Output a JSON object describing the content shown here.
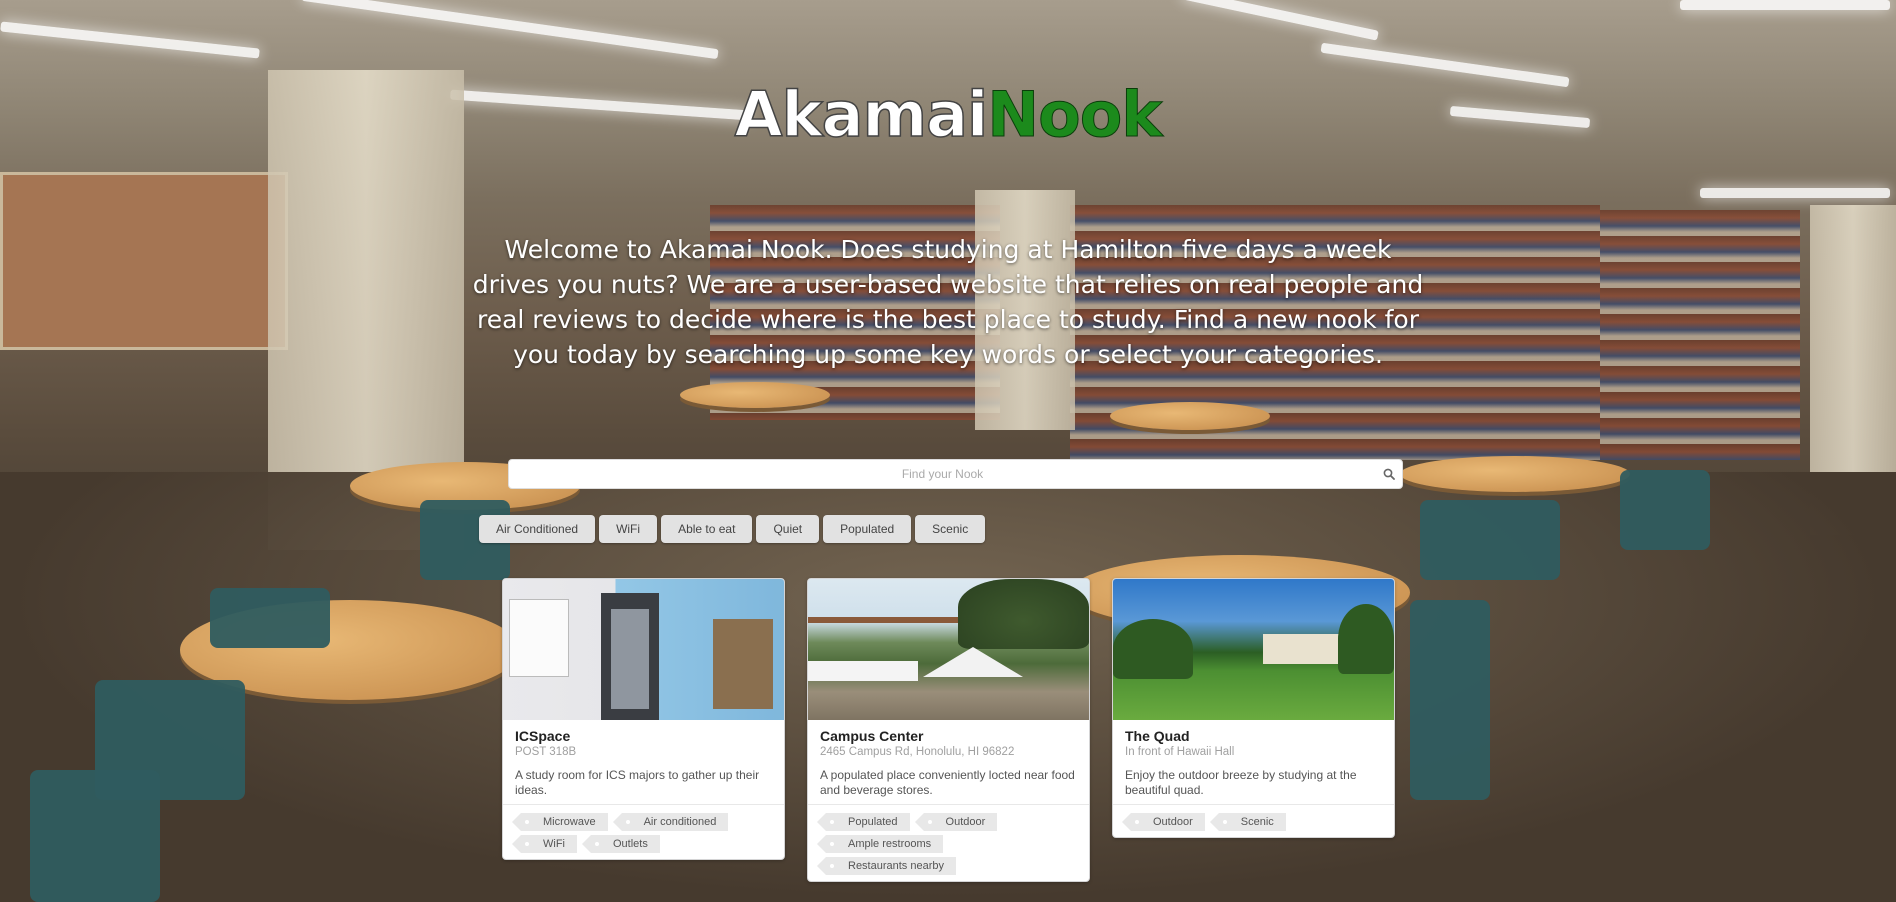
{
  "brand": {
    "name_part1": "Akamai",
    "name_part2": "Nook"
  },
  "welcome_text": "Welcome to Akamai Nook. Does studying at Hamilton five days a week drives you nuts? We are a user-based website that relies on real people and real reviews to decide where is the best place to study. Find a new nook for you today by searching up some key words or select your categories.",
  "search": {
    "placeholder": "Find your Nook",
    "icon": "search-icon"
  },
  "filters": [
    "Air Conditioned",
    "WiFi",
    "Able to eat",
    "Quiet",
    "Populated",
    "Scenic"
  ],
  "cards": [
    {
      "title": "ICSpace",
      "meta": "POST 318B",
      "description": "A study room for ICS majors to gather up their ideas.",
      "tags": [
        "Microwave",
        "Air conditioned",
        "WiFi",
        "Outlets"
      ]
    },
    {
      "title": "Campus Center",
      "meta": "2465 Campus Rd, Honolulu, HI 96822",
      "description": "A populated place conveniently locted near food and beverage stores.",
      "tags": [
        "Populated",
        "Outdoor",
        "Ample restrooms",
        "Restaurants nearby"
      ]
    },
    {
      "title": "The Quad",
      "meta": "In front of Hawaii Hall",
      "description": "Enjoy the outdoor breeze by studying at the beautiful quad.",
      "tags": [
        "Outdoor",
        "Scenic"
      ]
    }
  ],
  "colors": {
    "brand_green": "#1c8a1c",
    "filter_bg": "#e2e2e2",
    "tag_bg": "#e8e8e8"
  }
}
